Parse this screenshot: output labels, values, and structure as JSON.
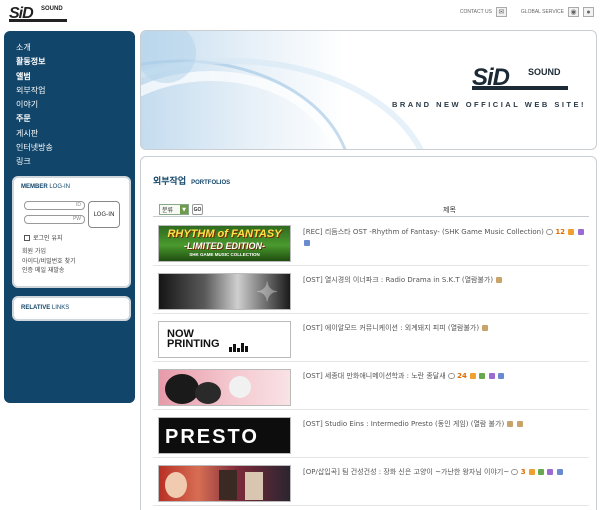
{
  "header": {
    "logo_main": "SiD",
    "logo_sound": "SOUND",
    "contact_label": "CONTACT US",
    "global_label": "GLOBAL SERVICE"
  },
  "sidebar": {
    "nav": [
      {
        "label": "소개",
        "bold": false
      },
      {
        "label": "활동정보",
        "bold": true
      },
      {
        "label": "앨범",
        "bold": true
      },
      {
        "label": "외부작업",
        "bold": false
      },
      {
        "label": "이야기",
        "bold": false
      },
      {
        "label": "주문",
        "bold": true
      },
      {
        "label": "게시판",
        "bold": false
      },
      {
        "label": "인터넷방송",
        "bold": false
      },
      {
        "label": "링크",
        "bold": false
      }
    ],
    "login": {
      "title_bold": "MEMBER",
      "title_rest": " LOG-IN",
      "id_placeholder": "ID",
      "pw_placeholder": "PW",
      "button_label": "LOG-IN",
      "keep_label": "로그인 유지",
      "links": [
        "회원 가입",
        "아이디/비밀번호 찾기",
        "인증 메일 재발송"
      ]
    },
    "relative": {
      "title_bold": "RELATIVE",
      "title_rest": " LINKS"
    }
  },
  "banner": {
    "logo_main": "SiD",
    "logo_sound": "SOUND",
    "tagline": "BRAND NEW OFFICIAL WEB SITE!"
  },
  "portfolio": {
    "title_ko": "외부작업",
    "title_en": "PORTFOLIOS",
    "filter_label": "분류",
    "go_label": "GO",
    "column_title": "제목",
    "rows": [
      {
        "title": "[REC] 리듬스타 OST -Rhythm of Fantasy- (SHK Game Music Collection)",
        "comments": "12",
        "thumb_text": "RHYTHM of FANTASY",
        "thumb_sub": "-LIMITED EDITION-",
        "thumb_sub2": "SHK GAME MUSIC COLLECTION"
      },
      {
        "title": "[OST] 열시경의 이너파크 : Radio Drama in S.K.T (열람불가)",
        "comments": "",
        "thumb_text": "",
        "thumb_sub": "",
        "thumb_sub2": ""
      },
      {
        "title": "[OST] 에이알모드 커뮤니케이션 : 외계돼지 피피 (열람불가)",
        "comments": "",
        "thumb_text": "NOW",
        "thumb_sub": "PRINTING",
        "thumb_sub2": ""
      },
      {
        "title": "[OST] 세종대 만화애니메이션학과 : 노란 종달새",
        "comments": "24",
        "thumb_text": "",
        "thumb_sub": "",
        "thumb_sub2": ""
      },
      {
        "title": "[OST] Studio Eins : Intermedio Presto (동인 게임) (열람 불가)",
        "comments": "",
        "thumb_text": "PRESTO",
        "thumb_sub": "",
        "thumb_sub2": ""
      },
      {
        "title": "[OP/삽입곡] 팀 건성건성 : 장화 신은 고양이 ~가난한 왕자님 이야기~",
        "comments": "3",
        "thumb_text": "",
        "thumb_sub": "",
        "thumb_sub2": ""
      }
    ]
  }
}
